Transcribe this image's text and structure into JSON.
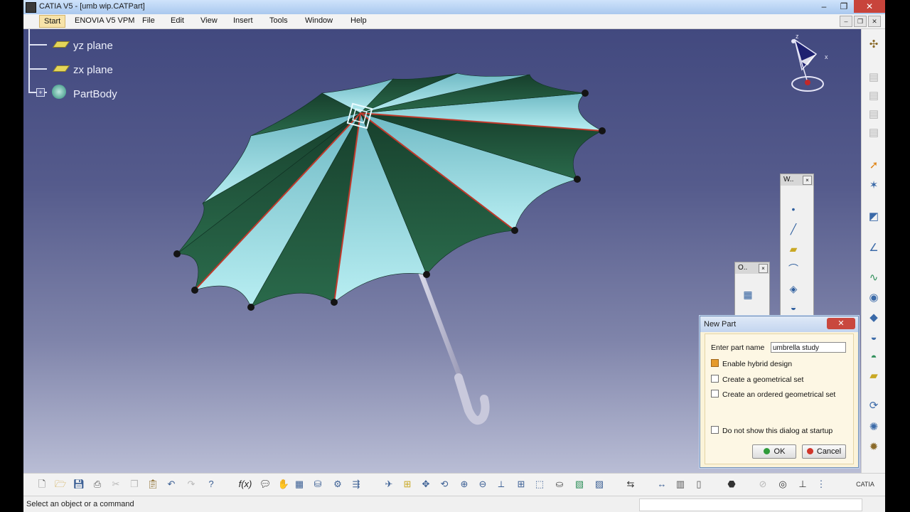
{
  "window": {
    "title": "CATIA V5 - [umb wip.CATPart]",
    "controls": {
      "minimize": "–",
      "maximize": "❐",
      "close": "✕"
    }
  },
  "menubar": {
    "items": [
      "Start",
      "ENOVIA V5 VPM",
      "File",
      "Edit",
      "View",
      "Insert",
      "Tools",
      "Window",
      "Help"
    ],
    "doc_controls": [
      "–",
      "❐",
      "✕"
    ]
  },
  "spec_tree": {
    "items": [
      {
        "label": "yz plane",
        "icon": "plane-icon"
      },
      {
        "label": "zx plane",
        "icon": "plane-icon"
      },
      {
        "label": "PartBody",
        "icon": "partbody-icon"
      }
    ]
  },
  "compass": {
    "x_label": "x",
    "z_label": "z"
  },
  "floating_toolbars": [
    {
      "title": "W..",
      "close": "×"
    },
    {
      "title": "O..",
      "close": "×"
    }
  ],
  "dialog": {
    "title": "New Part",
    "close": "✕",
    "part_name_label": "Enter part name",
    "part_name_value": "umbrella study",
    "options": [
      {
        "label": "Enable hybrid design",
        "checked": true
      },
      {
        "label": "Create a geometrical set",
        "checked": false
      },
      {
        "label": "Create an ordered geometrical set",
        "checked": false
      }
    ],
    "startup_option": {
      "label": "Do not show this dialog at startup",
      "checked": false
    },
    "ok_label": "OK",
    "cancel_label": "Cancel"
  },
  "status": {
    "text": "Select an object or a command"
  },
  "colors": {
    "viewport_top": "#42497f",
    "viewport_bottom": "#b9bdd5",
    "canopy_light": "#8fd3dd",
    "canopy_dark": "#1f5b3e",
    "rib_red": "#c0392b",
    "dialog_bg": "#fbf3d9"
  },
  "catia_logo": "CATIA"
}
